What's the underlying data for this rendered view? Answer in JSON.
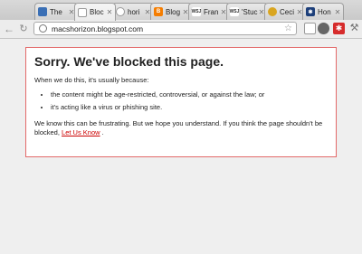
{
  "tabs": [
    {
      "label": "The",
      "favicon": "shield-favicon",
      "color": "#3a6fb5"
    },
    {
      "label": "Bloc",
      "favicon": "sad-page-favicon",
      "color": "#9a9a9a",
      "active": true
    },
    {
      "label": "hori",
      "favicon": "globe-favicon",
      "color": "#9a9a9a"
    },
    {
      "label": "Blog",
      "favicon": "blogger-favicon",
      "color": "#f57d00"
    },
    {
      "label": "Fran",
      "favicon": "wsj-favicon",
      "color": "#444444"
    },
    {
      "label": "'Stuc",
      "favicon": "wsj-favicon",
      "color": "#444444"
    },
    {
      "label": "Ceci",
      "favicon": "person-favicon",
      "color": "#d9a520"
    },
    {
      "label": "Hon",
      "favicon": "badge-favicon",
      "color": "#1d3f7a"
    }
  ],
  "toolbar": {
    "url": "macshorizon.blogspot.com"
  },
  "page": {
    "title": "Sorry. We've blocked this page.",
    "intro": "When we do this, it's usually because:",
    "reasons": [
      "the content might be age-restricted, controversial, or against the law; or",
      "it's acting like a virus or phishing site."
    ],
    "closing": "We know this can be frustrating. But we hope you understand. If you think the page shouldn't be blocked,",
    "link_text": "Let Us Know",
    "period": "."
  },
  "colors": {
    "accent_border": "#e36a6a",
    "link": "#cc0000"
  }
}
